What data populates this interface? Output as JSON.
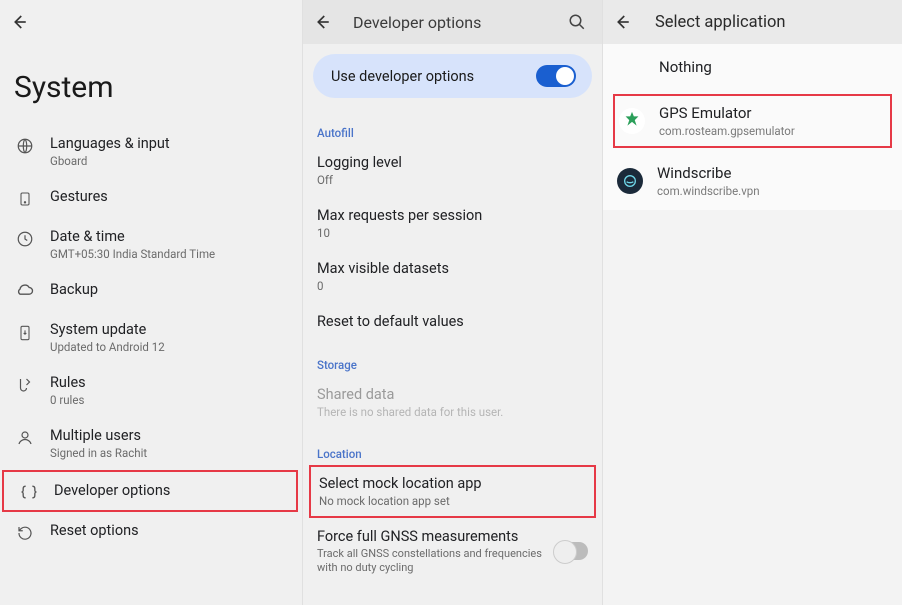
{
  "panel1": {
    "title": "System",
    "items": [
      {
        "label": "Languages & input",
        "sub": "Gboard"
      },
      {
        "label": "Gestures",
        "sub": ""
      },
      {
        "label": "Date & time",
        "sub": "GMT+05:30 India Standard Time"
      },
      {
        "label": "Backup",
        "sub": ""
      },
      {
        "label": "System update",
        "sub": "Updated to Android 12"
      },
      {
        "label": "Rules",
        "sub": "0 rules"
      },
      {
        "label": "Multiple users",
        "sub": "Signed in as Rachit"
      },
      {
        "label": "Developer options",
        "sub": ""
      },
      {
        "label": "Reset options",
        "sub": ""
      }
    ]
  },
  "panel2": {
    "title": "Developer options",
    "use_dev": "Use developer options",
    "sections": {
      "autofill": "Autofill",
      "storage": "Storage",
      "location": "Location"
    },
    "items": {
      "logging_level": {
        "label": "Logging level",
        "sub": "Off"
      },
      "max_requests": {
        "label": "Max requests per session",
        "sub": "10"
      },
      "max_datasets": {
        "label": "Max visible datasets",
        "sub": "0"
      },
      "reset_defaults": {
        "label": "Reset to default values"
      },
      "shared_data": {
        "label": "Shared data",
        "sub": "There is no shared data for this user."
      },
      "mock_location": {
        "label": "Select mock location app",
        "sub": "No mock location app set"
      },
      "force_gnss": {
        "label": "Force full GNSS measurements",
        "sub": "Track all GNSS constellations and frequencies with no duty cycling"
      }
    }
  },
  "panel3": {
    "title": "Select application",
    "nothing": "Nothing",
    "apps": [
      {
        "label": "GPS Emulator",
        "sub": "com.rosteam.gpsemulator"
      },
      {
        "label": "Windscribe",
        "sub": "com.windscribe.vpn"
      }
    ]
  }
}
